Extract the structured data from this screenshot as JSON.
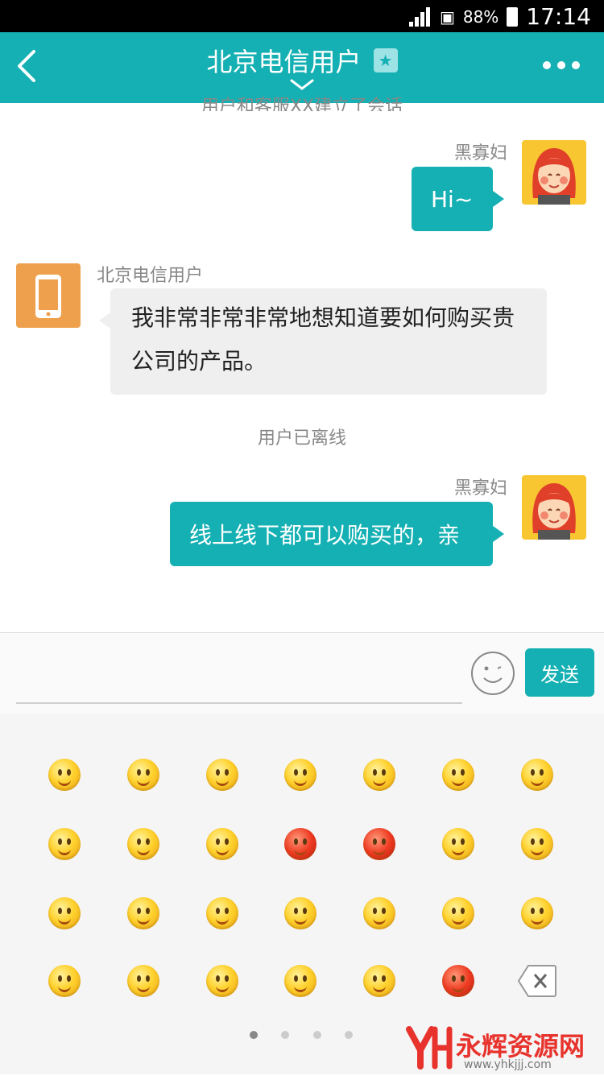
{
  "status_bar": {
    "battery": "88%",
    "time": "17:14"
  },
  "header": {
    "title": "北京电信用户"
  },
  "messages": {
    "system_top": "用户和客服XX建立了会话",
    "msg1": {
      "sender": "黑寡妇",
      "text": "Hi~"
    },
    "msg2": {
      "sender": "北京电信用户",
      "text": "我非常非常非常地想知道要如何购买贵公司的产品。"
    },
    "system_mid": "用户已离线",
    "msg3": {
      "sender": "黑寡妇",
      "text": "线上线下都可以购买的，亲"
    }
  },
  "composer": {
    "input_value": "",
    "send_label": "发送"
  },
  "emoji_panel": {
    "page_count": 4,
    "active_page": 1
  },
  "watermark": {
    "text": "永辉资源网",
    "url": "www.yhkjjj.com"
  },
  "colors": {
    "accent": "#14b0b3",
    "girl_bg": "#f7c631",
    "phone_bg": "#eea04c"
  }
}
